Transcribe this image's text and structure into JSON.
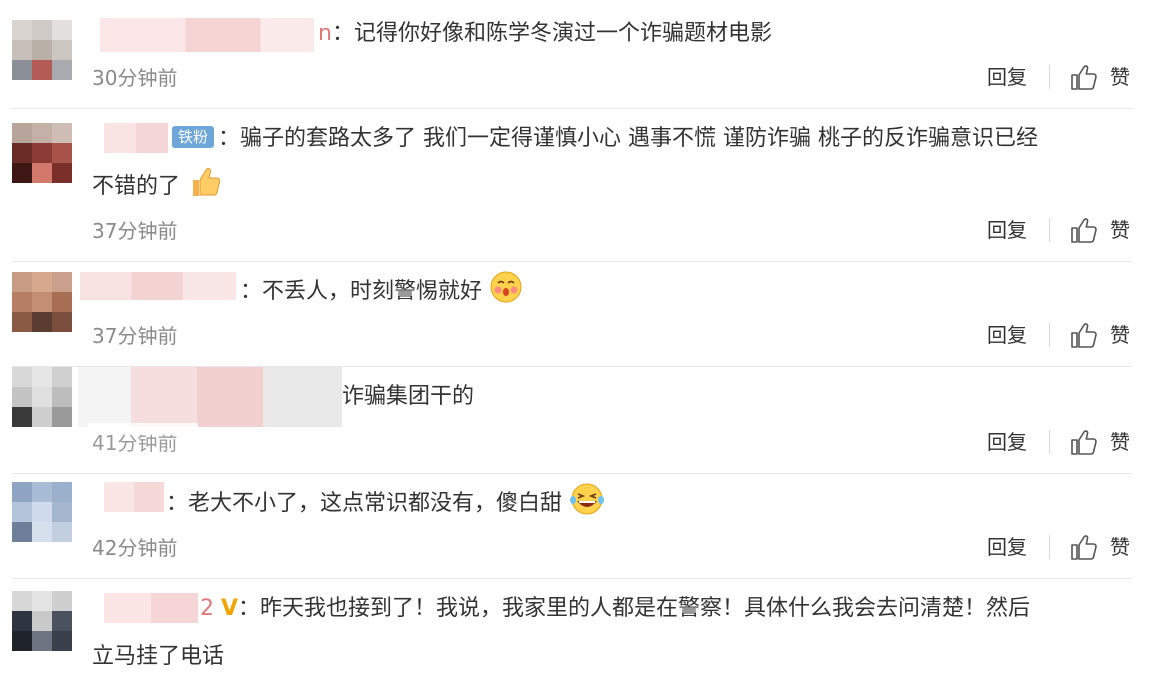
{
  "comments": [
    {
      "text": "：记得你好像和陈学冬演过一个诈骗题材电影",
      "name_fragment": "n",
      "time": "30分钟前"
    },
    {
      "badge": "铁粉",
      "text": "：骗子的套路太多了 我们一定得谨慎小心 遇事不慌 谨防诈骗 桃子的反诈骗意识已经",
      "text_line2": "不错的了",
      "emoji": "thumbs-up-emoji",
      "time": "37分钟前"
    },
    {
      "text": "：不丢人，时刻警惕就好",
      "emoji": "blushing-face-emoji",
      "time": "37分钟前"
    },
    {
      "text": "诈骗集团干的",
      "time": "41分钟前"
    },
    {
      "text": "：老大不小了，这点常识都没有，傻白甜",
      "emoji": "laughing-tears-emoji",
      "time": "42分钟前"
    },
    {
      "name_fragment": "2",
      "vip_mark": "V",
      "text": "：昨天我也接到了！我说，我家里的人都是在警察！具体什么我会去问清楚！然后",
      "text_line2": "立马挂了电话"
    }
  ],
  "actions": {
    "reply_label": "回复",
    "like_label": "赞",
    "like_icon": "thumbs-up-outline-icon"
  },
  "colors": {
    "time_gray": "#8a8a8a",
    "badge_blue": "#6ea6d9",
    "vip_gold": "#f2a500",
    "separator": "#e6e6e6"
  }
}
